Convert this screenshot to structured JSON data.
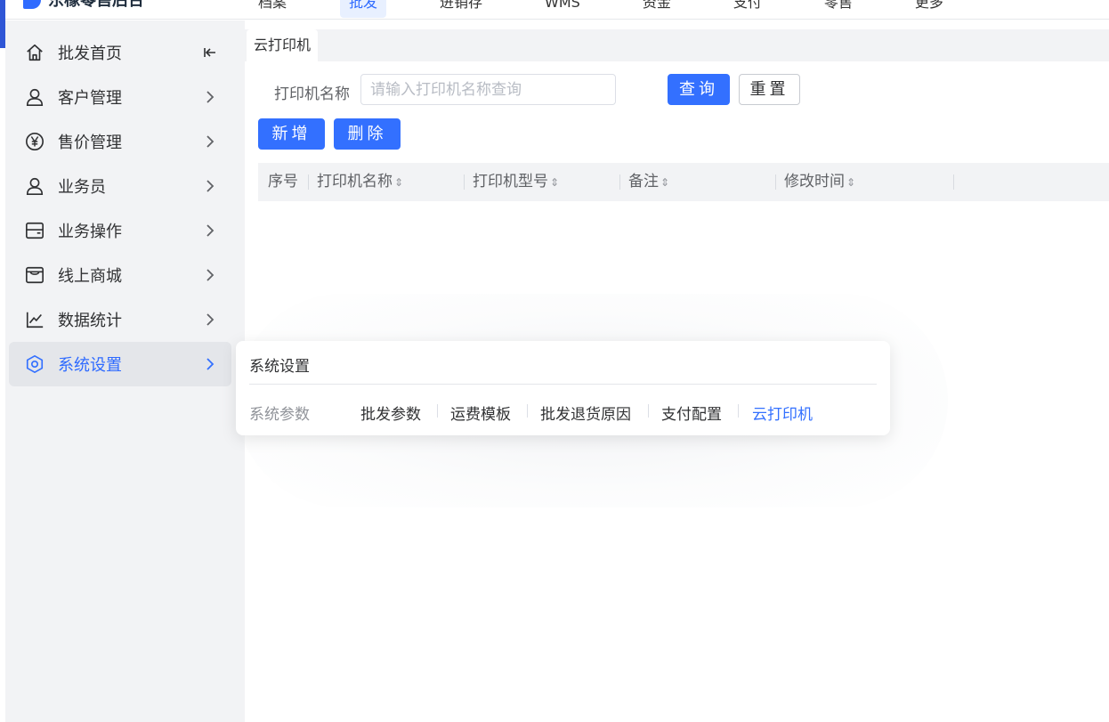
{
  "app": {
    "name": "东橡零售后台"
  },
  "topnav": {
    "items": [
      {
        "label": "档案"
      },
      {
        "label": "批发"
      },
      {
        "label": "进销存"
      },
      {
        "label": "WMS"
      },
      {
        "label": "资金"
      },
      {
        "label": "支付"
      },
      {
        "label": "零售"
      },
      {
        "label": "更多"
      }
    ]
  },
  "sidebar": {
    "items": [
      {
        "label": "批发首页",
        "icon": "home-icon"
      },
      {
        "label": "客户管理",
        "icon": "user-icon"
      },
      {
        "label": "售价管理",
        "icon": "yen-icon"
      },
      {
        "label": "业务员",
        "icon": "user-icon"
      },
      {
        "label": "业务操作",
        "icon": "wallet-icon"
      },
      {
        "label": "线上商城",
        "icon": "store-icon"
      },
      {
        "label": "数据统计",
        "icon": "chart-line-icon"
      },
      {
        "label": "系统设置",
        "icon": "gear-hex-icon"
      }
    ],
    "active_index": 7
  },
  "tabs": {
    "active": "云打印机"
  },
  "search": {
    "label": "打印机名称",
    "placeholder": "请输入打印机名称查询",
    "value": "",
    "query_label": "查询",
    "reset_label": "重置"
  },
  "actions": {
    "add_label": "新增",
    "delete_label": "删除"
  },
  "table": {
    "columns": [
      {
        "label": "序号",
        "sortable": false
      },
      {
        "label": "打印机名称",
        "sortable": true
      },
      {
        "label": "打印机型号",
        "sortable": true
      },
      {
        "label": "备注",
        "sortable": true
      },
      {
        "label": "修改时间",
        "sortable": true
      }
    ],
    "rows": []
  },
  "popup": {
    "title": "系统设置",
    "group_label": "系统参数",
    "links": [
      {
        "label": "批发参数"
      },
      {
        "label": "运费模板"
      },
      {
        "label": "批发退货原因"
      },
      {
        "label": "支付配置"
      },
      {
        "label": "云打印机"
      }
    ],
    "active_link": "云打印机"
  },
  "colors": {
    "accent": "#3370ff",
    "sidebar_bg": "#f2f3f5"
  }
}
